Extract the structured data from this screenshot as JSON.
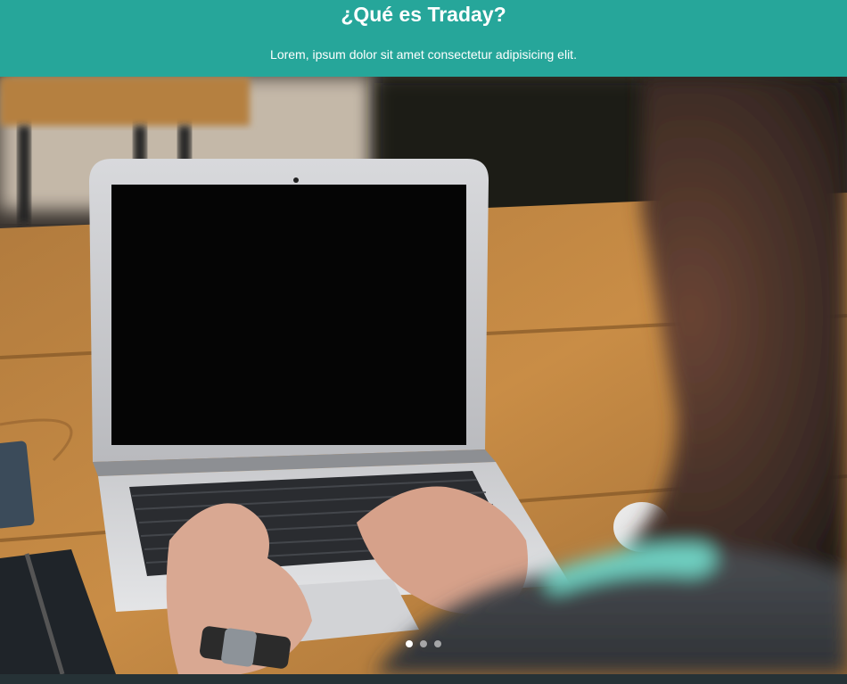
{
  "header": {
    "title": "¿Qué es Traday?",
    "subtitle": "Lorem, ipsum dolor sit amet consectetur adipisicing elit."
  },
  "slider": {
    "slide_count": 3,
    "active_index": 0,
    "image_subject": "person typing on laptop at wooden table"
  },
  "colors": {
    "header_bg": "#26a69a",
    "header_text": "#ffffff",
    "footer_strip": "#263236"
  }
}
